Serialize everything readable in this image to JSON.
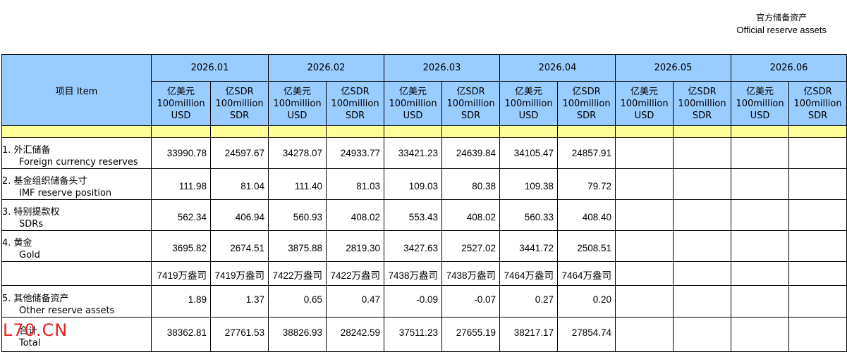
{
  "title": {
    "zh": "官方储备资产",
    "en": "Official reserve assets"
  },
  "header": {
    "item_label": "项目  Item",
    "months": [
      "2026.01",
      "2026.02",
      "2026.03",
      "2026.04",
      "2026.05",
      "2026.06"
    ],
    "unit_usd": {
      "zh": "亿美元",
      "en1": "100million",
      "en2": "USD"
    },
    "unit_sdr": {
      "zh": "亿SDR",
      "en1": "100million",
      "en2": "SDR"
    }
  },
  "rows": [
    {
      "label_zh": "1.  外汇储备",
      "label_en": "Foreign currency reserves",
      "values": [
        "33990.78",
        "24597.67",
        "34278.07",
        "24933.77",
        "33421.23",
        "24639.84",
        "34105.47",
        "24857.91",
        "",
        "",
        "",
        ""
      ]
    },
    {
      "label_zh": "2.  基金组织储备头寸",
      "label_en": "IMF reserve position",
      "values": [
        "111.98",
        "81.04",
        "111.40",
        "81.03",
        "109.03",
        "80.38",
        "109.38",
        "79.72",
        "",
        "",
        "",
        ""
      ]
    },
    {
      "label_zh": "3.  特别提款权",
      "label_en": "SDRs",
      "values": [
        "562.34",
        "406.94",
        "560.93",
        "408.02",
        "553.43",
        "408.02",
        "560.33",
        "408.40",
        "",
        "",
        "",
        ""
      ]
    },
    {
      "label_zh": "4.  黄金",
      "label_en": "Gold",
      "values": [
        "3695.82",
        "2674.51",
        "3875.88",
        "2819.30",
        "3427.63",
        "2527.02",
        "3441.72",
        "2508.51",
        "",
        "",
        "",
        ""
      ]
    },
    {
      "label_zh": "",
      "label_en": "",
      "values": [
        "7419万盎司",
        "7419万盎司",
        "7422万盎司",
        "7422万盎司",
        "7438万盎司",
        "7438万盎司",
        "7464万盎司",
        "7464万盎司",
        "",
        "",
        "",
        ""
      ]
    },
    {
      "label_zh": "5.  其他储备资产",
      "label_en": "Other reserve assets",
      "values": [
        "1.89",
        "1.37",
        "0.65",
        "0.47",
        "-0.09",
        "-0.07",
        "0.27",
        "0.20",
        "",
        "",
        "",
        ""
      ]
    },
    {
      "label_zh": "合计",
      "label_en": "Total",
      "values": [
        "38362.81",
        "27761.53",
        "38826.93",
        "28242.59",
        "37511.23",
        "27655.19",
        "38217.17",
        "27854.74",
        "",
        "",
        "",
        ""
      ]
    }
  ],
  "watermark": "L70.CN"
}
